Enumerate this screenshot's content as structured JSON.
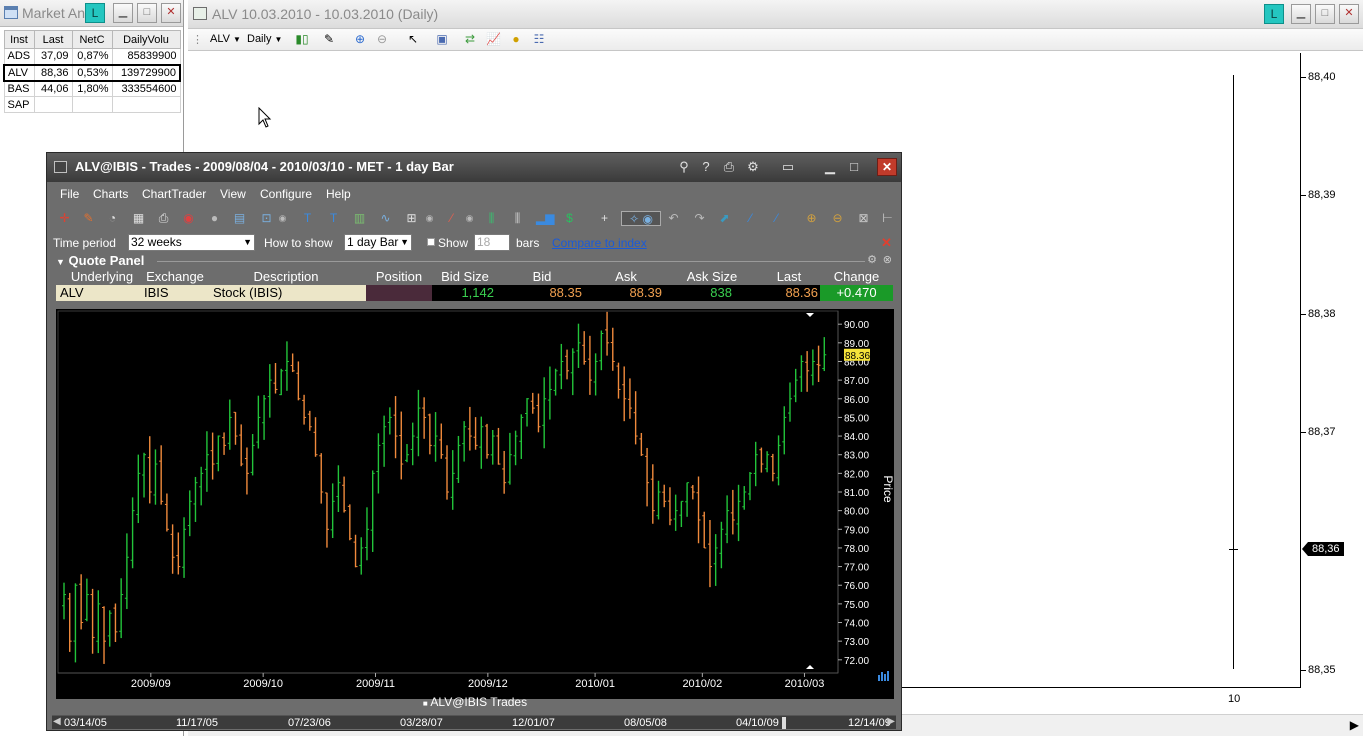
{
  "market_analyzer": {
    "title": "Market An",
    "l_badge": "L",
    "columns": [
      "Inst",
      "Last",
      "NetC",
      "DailyVolu"
    ],
    "rows": [
      {
        "inst": "ADS",
        "last": "37,09",
        "netc": "0,87%",
        "vol": "85839900"
      },
      {
        "inst": "ALV",
        "last": "88,36",
        "netc": "0,53%",
        "vol": "139729900"
      },
      {
        "inst": "BAS",
        "last": "44,06",
        "netc": "1,80%",
        "vol": "333554600"
      },
      {
        "inst": "SAP",
        "last": "",
        "netc": "",
        "vol": ""
      }
    ]
  },
  "bg_chart": {
    "title": "ALV  10.03.2010 - 10.03.2010 (Daily)",
    "l_badge": "L",
    "toolbar": {
      "instrument": "ALV",
      "interval": "Daily"
    },
    "price_labels": [
      "88,40",
      "88,39",
      "88,38",
      "88,37",
      "88,36",
      "88,35"
    ],
    "current_price": "88,36",
    "x_label": "10"
  },
  "fg_chart": {
    "title": "ALV@IBIS - Trades - 2009/08/04 - 2010/03/10 - MET - 1 day Bar",
    "menu": [
      "File",
      "Charts",
      "ChartTrader",
      "View",
      "Configure",
      "Help"
    ],
    "params": {
      "time_period_label": "Time period",
      "time_period_value": "32 weeks",
      "how_to_show_label": "How to show",
      "how_to_show_value": "1 day Bar",
      "show_label": "Show",
      "show_value": "18",
      "bars_label": "bars",
      "compare_link": "Compare to index"
    },
    "quote_panel": {
      "title": "Quote Panel",
      "headers": [
        "Underlying",
        "Exchange",
        "Description",
        "Position",
        "Bid Size",
        "Bid",
        "Ask",
        "Ask Size",
        "Last",
        "Change"
      ],
      "values": [
        "ALV",
        "IBIS",
        "Stock (IBIS)",
        "",
        "1,142",
        "88.35",
        "88.39",
        "838",
        "88.36",
        "+0.470"
      ]
    },
    "legend": "ALV@IBIS Trades",
    "nav_dates": [
      "03/14/05",
      "11/17/05",
      "07/23/06",
      "03/28/07",
      "12/01/07",
      "08/05/08",
      "04/10/09",
      "12/14/09"
    ]
  },
  "chart_data": {
    "type": "ohlc",
    "y_axis_title": "Price",
    "ylim": [
      71.4,
      90.6
    ],
    "y_ticks": [
      "72.00",
      "73.00",
      "74.00",
      "75.00",
      "76.00",
      "77.00",
      "78.00",
      "79.00",
      "80.00",
      "81.00",
      "82.00",
      "83.00",
      "84.00",
      "85.00",
      "86.00",
      "87.00",
      "88.00",
      "89.00",
      "90.00"
    ],
    "x_ticks": [
      "2009/09",
      "2009/10",
      "2009/11",
      "2009/12",
      "2010/01",
      "2010/02",
      "2010/03"
    ],
    "x_tick_positions": [
      17,
      39,
      61,
      83,
      104,
      125,
      145
    ],
    "last_price": "88.36",
    "colors": {
      "up": "#22c43a",
      "down": "#f08a3c",
      "last_badge": "#f5e23a"
    },
    "closes": [
      75.5,
      73.0,
      76.0,
      74.0,
      75.5,
      73.2,
      75.0,
      73.0,
      74.5,
      73.5,
      75.5,
      77.5,
      80.0,
      82.0,
      83.0,
      81.0,
      82.5,
      80.5,
      79.0,
      77.5,
      77.0,
      79.0,
      80.5,
      81.5,
      82.0,
      83.0,
      82.5,
      84.0,
      83.5,
      85.0,
      84.0,
      82.5,
      82.0,
      83.5,
      85.0,
      86.0,
      87.0,
      86.5,
      87.5,
      88.0,
      87.5,
      86.0,
      85.0,
      84.5,
      83.0,
      81.0,
      79.0,
      80.5,
      81.5,
      80.0,
      78.5,
      77.0,
      78.0,
      79.0,
      82.0,
      83.5,
      84.5,
      85.0,
      84.0,
      82.5,
      83.0,
      84.0,
      85.5,
      85.0,
      83.5,
      84.0,
      83.0,
      81.0,
      82.0,
      83.5,
      84.5,
      84.0,
      83.5,
      84.5,
      83.0,
      84.0,
      82.5,
      81.5,
      83.0,
      84.0,
      85.0,
      86.0,
      85.5,
      84.5,
      86.0,
      86.5,
      87.5,
      88.0,
      87.5,
      88.5,
      89.0,
      88.0,
      87.0,
      88.0,
      89.5,
      89.0,
      88.0,
      86.5,
      86.0,
      85.5,
      84.0,
      83.0,
      81.5,
      80.0,
      81.0,
      80.5,
      79.5,
      80.0,
      80.5,
      81.5,
      81.0,
      79.5,
      78.0,
      77.0,
      78.0,
      79.0,
      80.0,
      79.5,
      80.5,
      81.0,
      82.0,
      83.0,
      82.5,
      83.0,
      82.0,
      83.5,
      85.0,
      86.0,
      87.0,
      88.0,
      87.5,
      88.0,
      87.8,
      88.36
    ],
    "volatility": 1.3,
    "series": [
      {
        "name": "ALV@IBIS Trades"
      }
    ]
  }
}
